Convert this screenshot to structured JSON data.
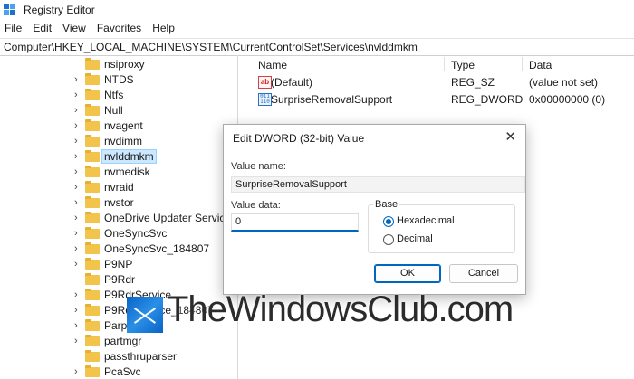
{
  "window": {
    "title": "Registry Editor"
  },
  "menu": [
    "File",
    "Edit",
    "View",
    "Favorites",
    "Help"
  ],
  "address": "Computer\\HKEY_LOCAL_MACHINE\\SYSTEM\\CurrentControlSet\\Services\\nvlddmkm",
  "tree": {
    "items": [
      {
        "label": "nsiproxy",
        "chevron": false
      },
      {
        "label": "NTDS",
        "chevron": true
      },
      {
        "label": "Ntfs",
        "chevron": true
      },
      {
        "label": "Null",
        "chevron": true
      },
      {
        "label": "nvagent",
        "chevron": true
      },
      {
        "label": "nvdimm",
        "chevron": true
      },
      {
        "label": "nvlddmkm",
        "chevron": true,
        "selected": true
      },
      {
        "label": "nvmedisk",
        "chevron": true
      },
      {
        "label": "nvraid",
        "chevron": true
      },
      {
        "label": "nvstor",
        "chevron": true
      },
      {
        "label": "OneDrive Updater Service",
        "chevron": true
      },
      {
        "label": "OneSyncSvc",
        "chevron": true
      },
      {
        "label": "OneSyncSvc_184807",
        "chevron": true
      },
      {
        "label": "P9NP",
        "chevron": true
      },
      {
        "label": "P9Rdr",
        "chevron": false
      },
      {
        "label": "P9RdrService",
        "chevron": true
      },
      {
        "label": "P9RdrService_184807",
        "chevron": true
      },
      {
        "label": "Parport",
        "chevron": true
      },
      {
        "label": "partmgr",
        "chevron": true
      },
      {
        "label": "passthruparser",
        "chevron": false
      },
      {
        "label": "PcaSvc",
        "chevron": true
      }
    ]
  },
  "values": {
    "columns": [
      "Name",
      "Type",
      "Data"
    ],
    "rows": [
      {
        "icon": "string-value-icon",
        "name": "(Default)",
        "type": "REG_SZ",
        "data": "(value not set)"
      },
      {
        "icon": "binary-value-icon",
        "name": "SurpriseRemovalSupport",
        "type": "REG_DWORD",
        "data": "0x00000000 (0)"
      }
    ]
  },
  "dialog": {
    "title": "Edit DWORD (32-bit) Value",
    "close_glyph": "✕",
    "value_name_label": "Value name:",
    "value_name": "SurpriseRemovalSupport",
    "value_data_label": "Value data:",
    "value_data": "0",
    "base_label": "Base",
    "hex_label": "Hexadecimal",
    "dec_label": "Decimal",
    "selected_base": "Hexadecimal",
    "ok_label": "OK",
    "cancel_label": "Cancel"
  },
  "watermark": {
    "text": "TheWindowsClub.com"
  },
  "colors": {
    "accent": "#0067c0",
    "folder": "#f2c44b",
    "selection": "#cce8ff"
  }
}
